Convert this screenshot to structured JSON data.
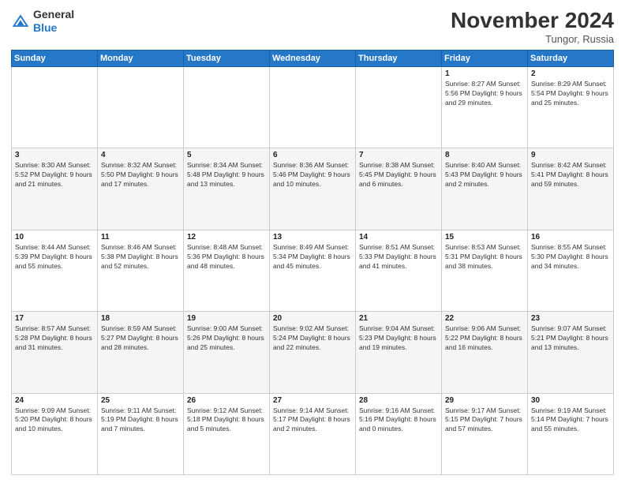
{
  "header": {
    "logo_line1": "General",
    "logo_line2": "Blue",
    "month": "November 2024",
    "location": "Tungor, Russia"
  },
  "weekdays": [
    "Sunday",
    "Monday",
    "Tuesday",
    "Wednesday",
    "Thursday",
    "Friday",
    "Saturday"
  ],
  "weeks": [
    [
      {
        "day": "",
        "info": ""
      },
      {
        "day": "",
        "info": ""
      },
      {
        "day": "",
        "info": ""
      },
      {
        "day": "",
        "info": ""
      },
      {
        "day": "",
        "info": ""
      },
      {
        "day": "1",
        "info": "Sunrise: 8:27 AM\nSunset: 5:56 PM\nDaylight: 9 hours and 29 minutes."
      },
      {
        "day": "2",
        "info": "Sunrise: 8:29 AM\nSunset: 5:54 PM\nDaylight: 9 hours and 25 minutes."
      }
    ],
    [
      {
        "day": "3",
        "info": "Sunrise: 8:30 AM\nSunset: 5:52 PM\nDaylight: 9 hours and 21 minutes."
      },
      {
        "day": "4",
        "info": "Sunrise: 8:32 AM\nSunset: 5:50 PM\nDaylight: 9 hours and 17 minutes."
      },
      {
        "day": "5",
        "info": "Sunrise: 8:34 AM\nSunset: 5:48 PM\nDaylight: 9 hours and 13 minutes."
      },
      {
        "day": "6",
        "info": "Sunrise: 8:36 AM\nSunset: 5:46 PM\nDaylight: 9 hours and 10 minutes."
      },
      {
        "day": "7",
        "info": "Sunrise: 8:38 AM\nSunset: 5:45 PM\nDaylight: 9 hours and 6 minutes."
      },
      {
        "day": "8",
        "info": "Sunrise: 8:40 AM\nSunset: 5:43 PM\nDaylight: 9 hours and 2 minutes."
      },
      {
        "day": "9",
        "info": "Sunrise: 8:42 AM\nSunset: 5:41 PM\nDaylight: 8 hours and 59 minutes."
      }
    ],
    [
      {
        "day": "10",
        "info": "Sunrise: 8:44 AM\nSunset: 5:39 PM\nDaylight: 8 hours and 55 minutes."
      },
      {
        "day": "11",
        "info": "Sunrise: 8:46 AM\nSunset: 5:38 PM\nDaylight: 8 hours and 52 minutes."
      },
      {
        "day": "12",
        "info": "Sunrise: 8:48 AM\nSunset: 5:36 PM\nDaylight: 8 hours and 48 minutes."
      },
      {
        "day": "13",
        "info": "Sunrise: 8:49 AM\nSunset: 5:34 PM\nDaylight: 8 hours and 45 minutes."
      },
      {
        "day": "14",
        "info": "Sunrise: 8:51 AM\nSunset: 5:33 PM\nDaylight: 8 hours and 41 minutes."
      },
      {
        "day": "15",
        "info": "Sunrise: 8:53 AM\nSunset: 5:31 PM\nDaylight: 8 hours and 38 minutes."
      },
      {
        "day": "16",
        "info": "Sunrise: 8:55 AM\nSunset: 5:30 PM\nDaylight: 8 hours and 34 minutes."
      }
    ],
    [
      {
        "day": "17",
        "info": "Sunrise: 8:57 AM\nSunset: 5:28 PM\nDaylight: 8 hours and 31 minutes."
      },
      {
        "day": "18",
        "info": "Sunrise: 8:59 AM\nSunset: 5:27 PM\nDaylight: 8 hours and 28 minutes."
      },
      {
        "day": "19",
        "info": "Sunrise: 9:00 AM\nSunset: 5:26 PM\nDaylight: 8 hours and 25 minutes."
      },
      {
        "day": "20",
        "info": "Sunrise: 9:02 AM\nSunset: 5:24 PM\nDaylight: 8 hours and 22 minutes."
      },
      {
        "day": "21",
        "info": "Sunrise: 9:04 AM\nSunset: 5:23 PM\nDaylight: 8 hours and 19 minutes."
      },
      {
        "day": "22",
        "info": "Sunrise: 9:06 AM\nSunset: 5:22 PM\nDaylight: 8 hours and 16 minutes."
      },
      {
        "day": "23",
        "info": "Sunrise: 9:07 AM\nSunset: 5:21 PM\nDaylight: 8 hours and 13 minutes."
      }
    ],
    [
      {
        "day": "24",
        "info": "Sunrise: 9:09 AM\nSunset: 5:20 PM\nDaylight: 8 hours and 10 minutes."
      },
      {
        "day": "25",
        "info": "Sunrise: 9:11 AM\nSunset: 5:19 PM\nDaylight: 8 hours and 7 minutes."
      },
      {
        "day": "26",
        "info": "Sunrise: 9:12 AM\nSunset: 5:18 PM\nDaylight: 8 hours and 5 minutes."
      },
      {
        "day": "27",
        "info": "Sunrise: 9:14 AM\nSunset: 5:17 PM\nDaylight: 8 hours and 2 minutes."
      },
      {
        "day": "28",
        "info": "Sunrise: 9:16 AM\nSunset: 5:16 PM\nDaylight: 8 hours and 0 minutes."
      },
      {
        "day": "29",
        "info": "Sunrise: 9:17 AM\nSunset: 5:15 PM\nDaylight: 7 hours and 57 minutes."
      },
      {
        "day": "30",
        "info": "Sunrise: 9:19 AM\nSunset: 5:14 PM\nDaylight: 7 hours and 55 minutes."
      }
    ]
  ]
}
